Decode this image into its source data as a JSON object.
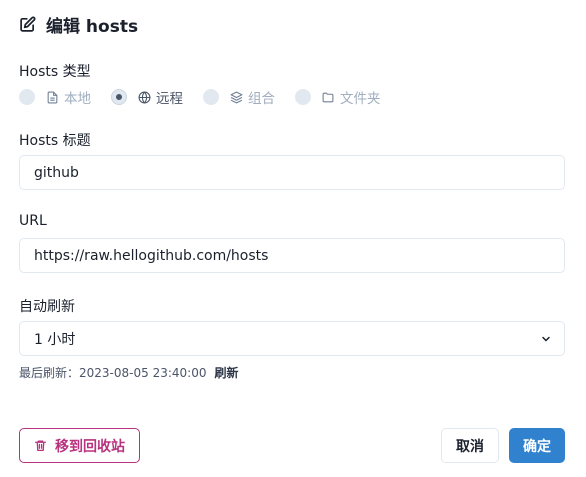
{
  "dialog": {
    "title": "编辑 hosts",
    "title_icon": "edit-icon"
  },
  "hosts_type": {
    "label": "Hosts 类型",
    "options": [
      {
        "label": "本地",
        "icon": "file-icon",
        "selected": false
      },
      {
        "label": "远程",
        "icon": "globe-icon",
        "selected": true
      },
      {
        "label": "组合",
        "icon": "layers-icon",
        "selected": false
      },
      {
        "label": "文件夹",
        "icon": "folder-icon",
        "selected": false
      }
    ]
  },
  "hosts_title": {
    "label": "Hosts 标题",
    "value": "github"
  },
  "url": {
    "label": "URL",
    "value": "https://raw.hellogithub.com/hosts"
  },
  "auto_refresh": {
    "label": "自动刷新",
    "value": "1 小时",
    "last_refresh_label": "最后刷新：",
    "last_refresh_time": "2023-08-05 23:40:00",
    "refresh_link": "刷新"
  },
  "buttons": {
    "trash": "移到回收站",
    "cancel": "取消",
    "ok": "确定"
  },
  "colors": {
    "accent": "#3182ce",
    "danger": "#b83280"
  }
}
